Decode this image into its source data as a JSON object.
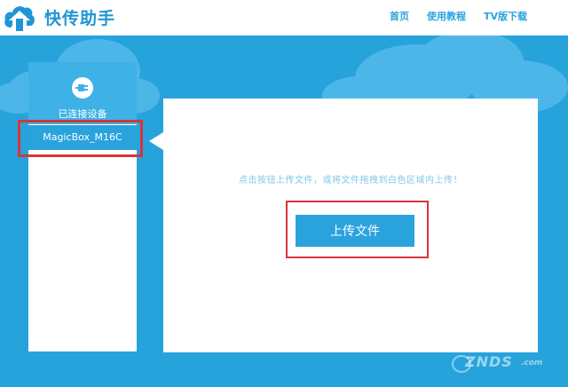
{
  "header": {
    "app_title": "快传助手",
    "logo_icon": "cloud-upload-logo-icon",
    "nav": [
      {
        "label": "首页"
      },
      {
        "label": "使用教程"
      },
      {
        "label": "TV版下载"
      }
    ]
  },
  "sidebar": {
    "icon": "plug-icon",
    "connected_label": "已连接设备",
    "devices": [
      {
        "name": "MagicBox_M16C"
      }
    ]
  },
  "main": {
    "hint": "点击按钮上传文件，或将文件拖拽到白色区域内上传！",
    "upload_button": "上传文件"
  },
  "watermark": {
    "text": "ZNDS",
    "suffix": ".com"
  },
  "colors": {
    "background": "#27a3dc",
    "accent": "#2aa3dd",
    "highlight_box": "#d8343a",
    "header_bg": "#ffffff"
  }
}
